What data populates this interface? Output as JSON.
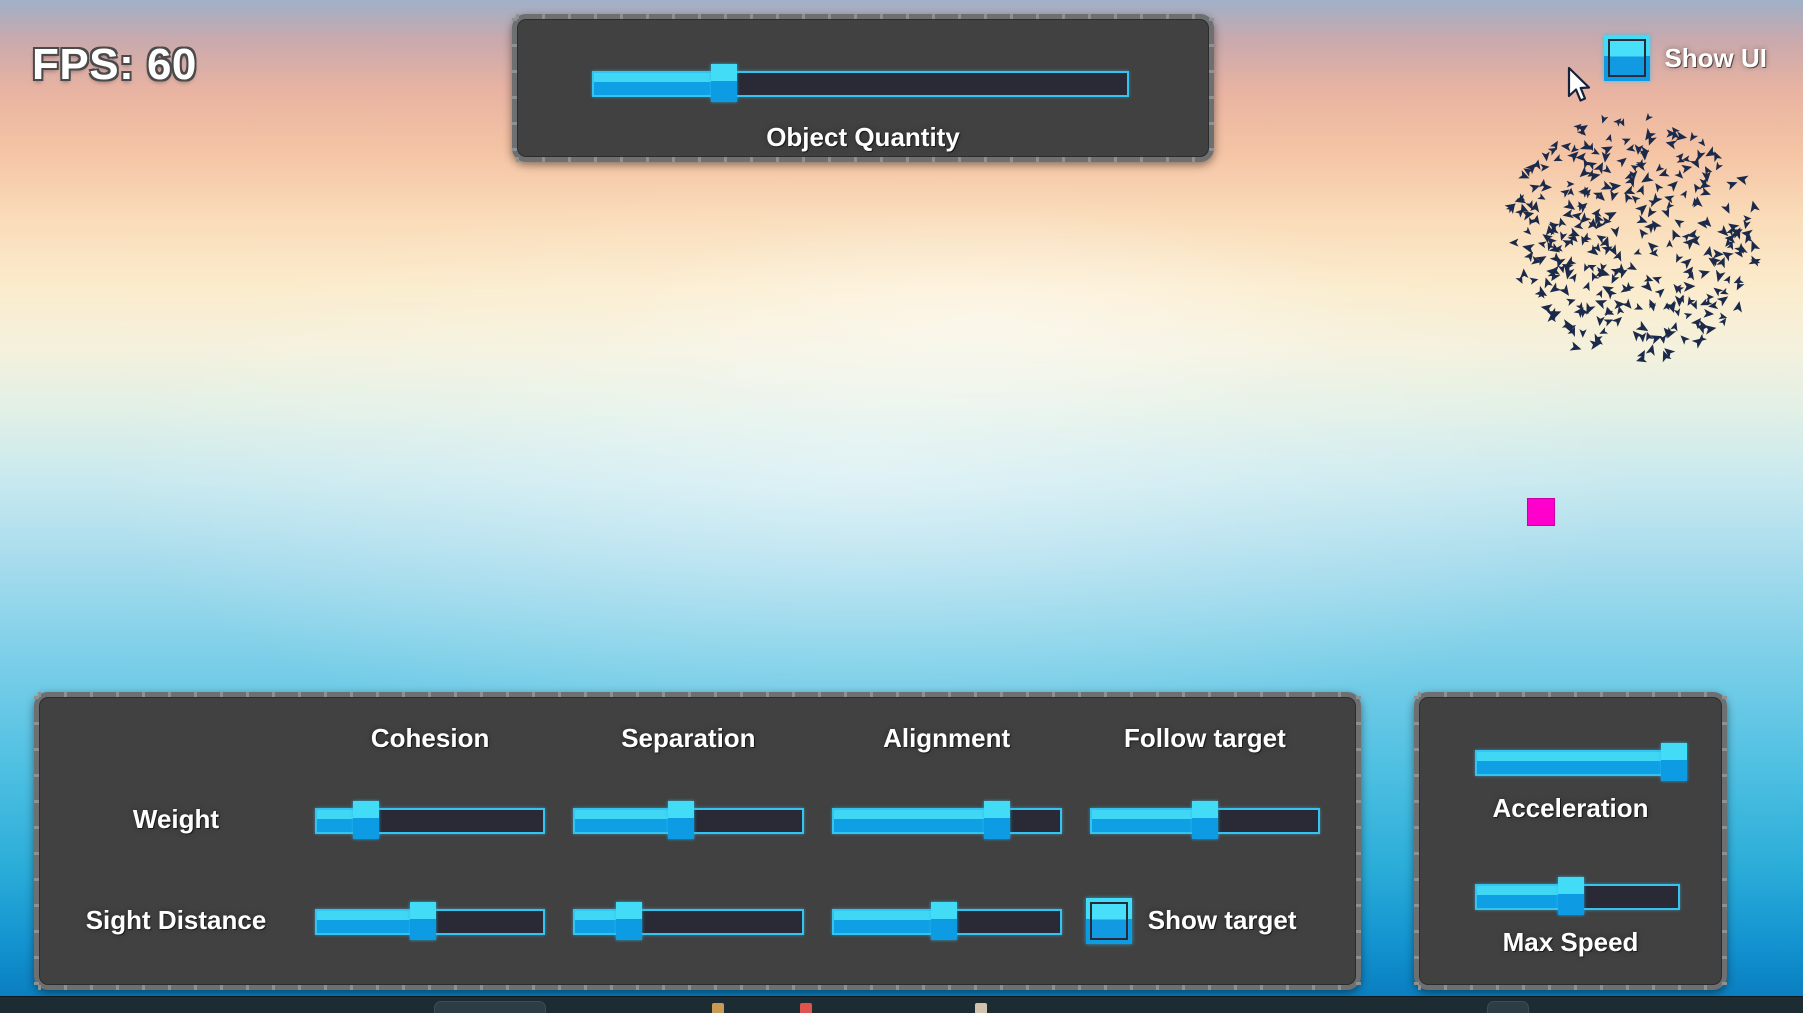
{
  "hud": {
    "fps_label": "FPS: 60"
  },
  "top_panel": {
    "slider_label": "Object Quantity",
    "slider_value_pct": 24.5
  },
  "show_ui": {
    "label": "Show UI",
    "checked": true,
    "icon": "checkbox-checked-icon"
  },
  "cursor": {
    "icon": "mouse-pointer-icon"
  },
  "target": {
    "name": "target-marker",
    "color": "#ff00cc"
  },
  "controls_panel": {
    "column_headers": [
      "Cohesion",
      "Separation",
      "Alignment",
      "Follow target"
    ],
    "row_headers": [
      "Weight",
      "Sight Distance"
    ],
    "weight_sliders": [
      {
        "name": "cohesion-weight",
        "value_pct": 22
      },
      {
        "name": "separation-weight",
        "value_pct": 47
      },
      {
        "name": "alignment-weight",
        "value_pct": 72
      },
      {
        "name": "follow-target-weight",
        "value_pct": 50
      }
    ],
    "sight_sliders": [
      {
        "name": "cohesion-sight-distance",
        "value_pct": 47
      },
      {
        "name": "separation-sight-distance",
        "value_pct": 24
      },
      {
        "name": "alignment-sight-distance",
        "value_pct": 49
      }
    ],
    "show_target": {
      "label": "Show target",
      "checked": true,
      "icon": "checkbox-checked-icon"
    }
  },
  "motion_panel": {
    "acceleration": {
      "label": "Acceleration",
      "value_pct": 97
    },
    "max_speed": {
      "label": "Max Speed",
      "value_pct": 47
    }
  },
  "colors": {
    "accent_light": "#3fd7f4",
    "accent_dark": "#0f9fe5",
    "panel_bg": "#414141",
    "panel_border": "#6d6f70",
    "track_bg": "#2a2a36",
    "target": "#ff00cc",
    "boid": "#1b2a4a"
  }
}
